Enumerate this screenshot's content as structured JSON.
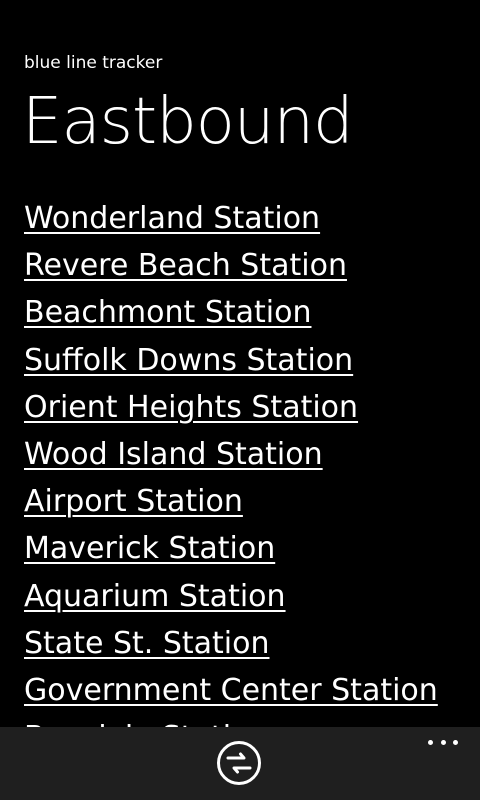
{
  "app": {
    "title": "blue line tracker"
  },
  "page": {
    "title": "Eastbound"
  },
  "stations": [
    "Wonderland Station",
    "Revere Beach Station",
    "Beachmont Station",
    "Suffolk Downs Station",
    "Orient Heights Station",
    "Wood Island Station",
    "Airport Station",
    "Maverick Station",
    "Aquarium Station",
    "State St. Station",
    "Government Center Station",
    "Bowdoin Station"
  ],
  "app_bar": {
    "primary_icon": "switch-direction-icon",
    "more_icon": "more-icon"
  },
  "colors": {
    "background": "#000000",
    "text": "#ffffff",
    "app_bar": "#1f1f1f"
  }
}
